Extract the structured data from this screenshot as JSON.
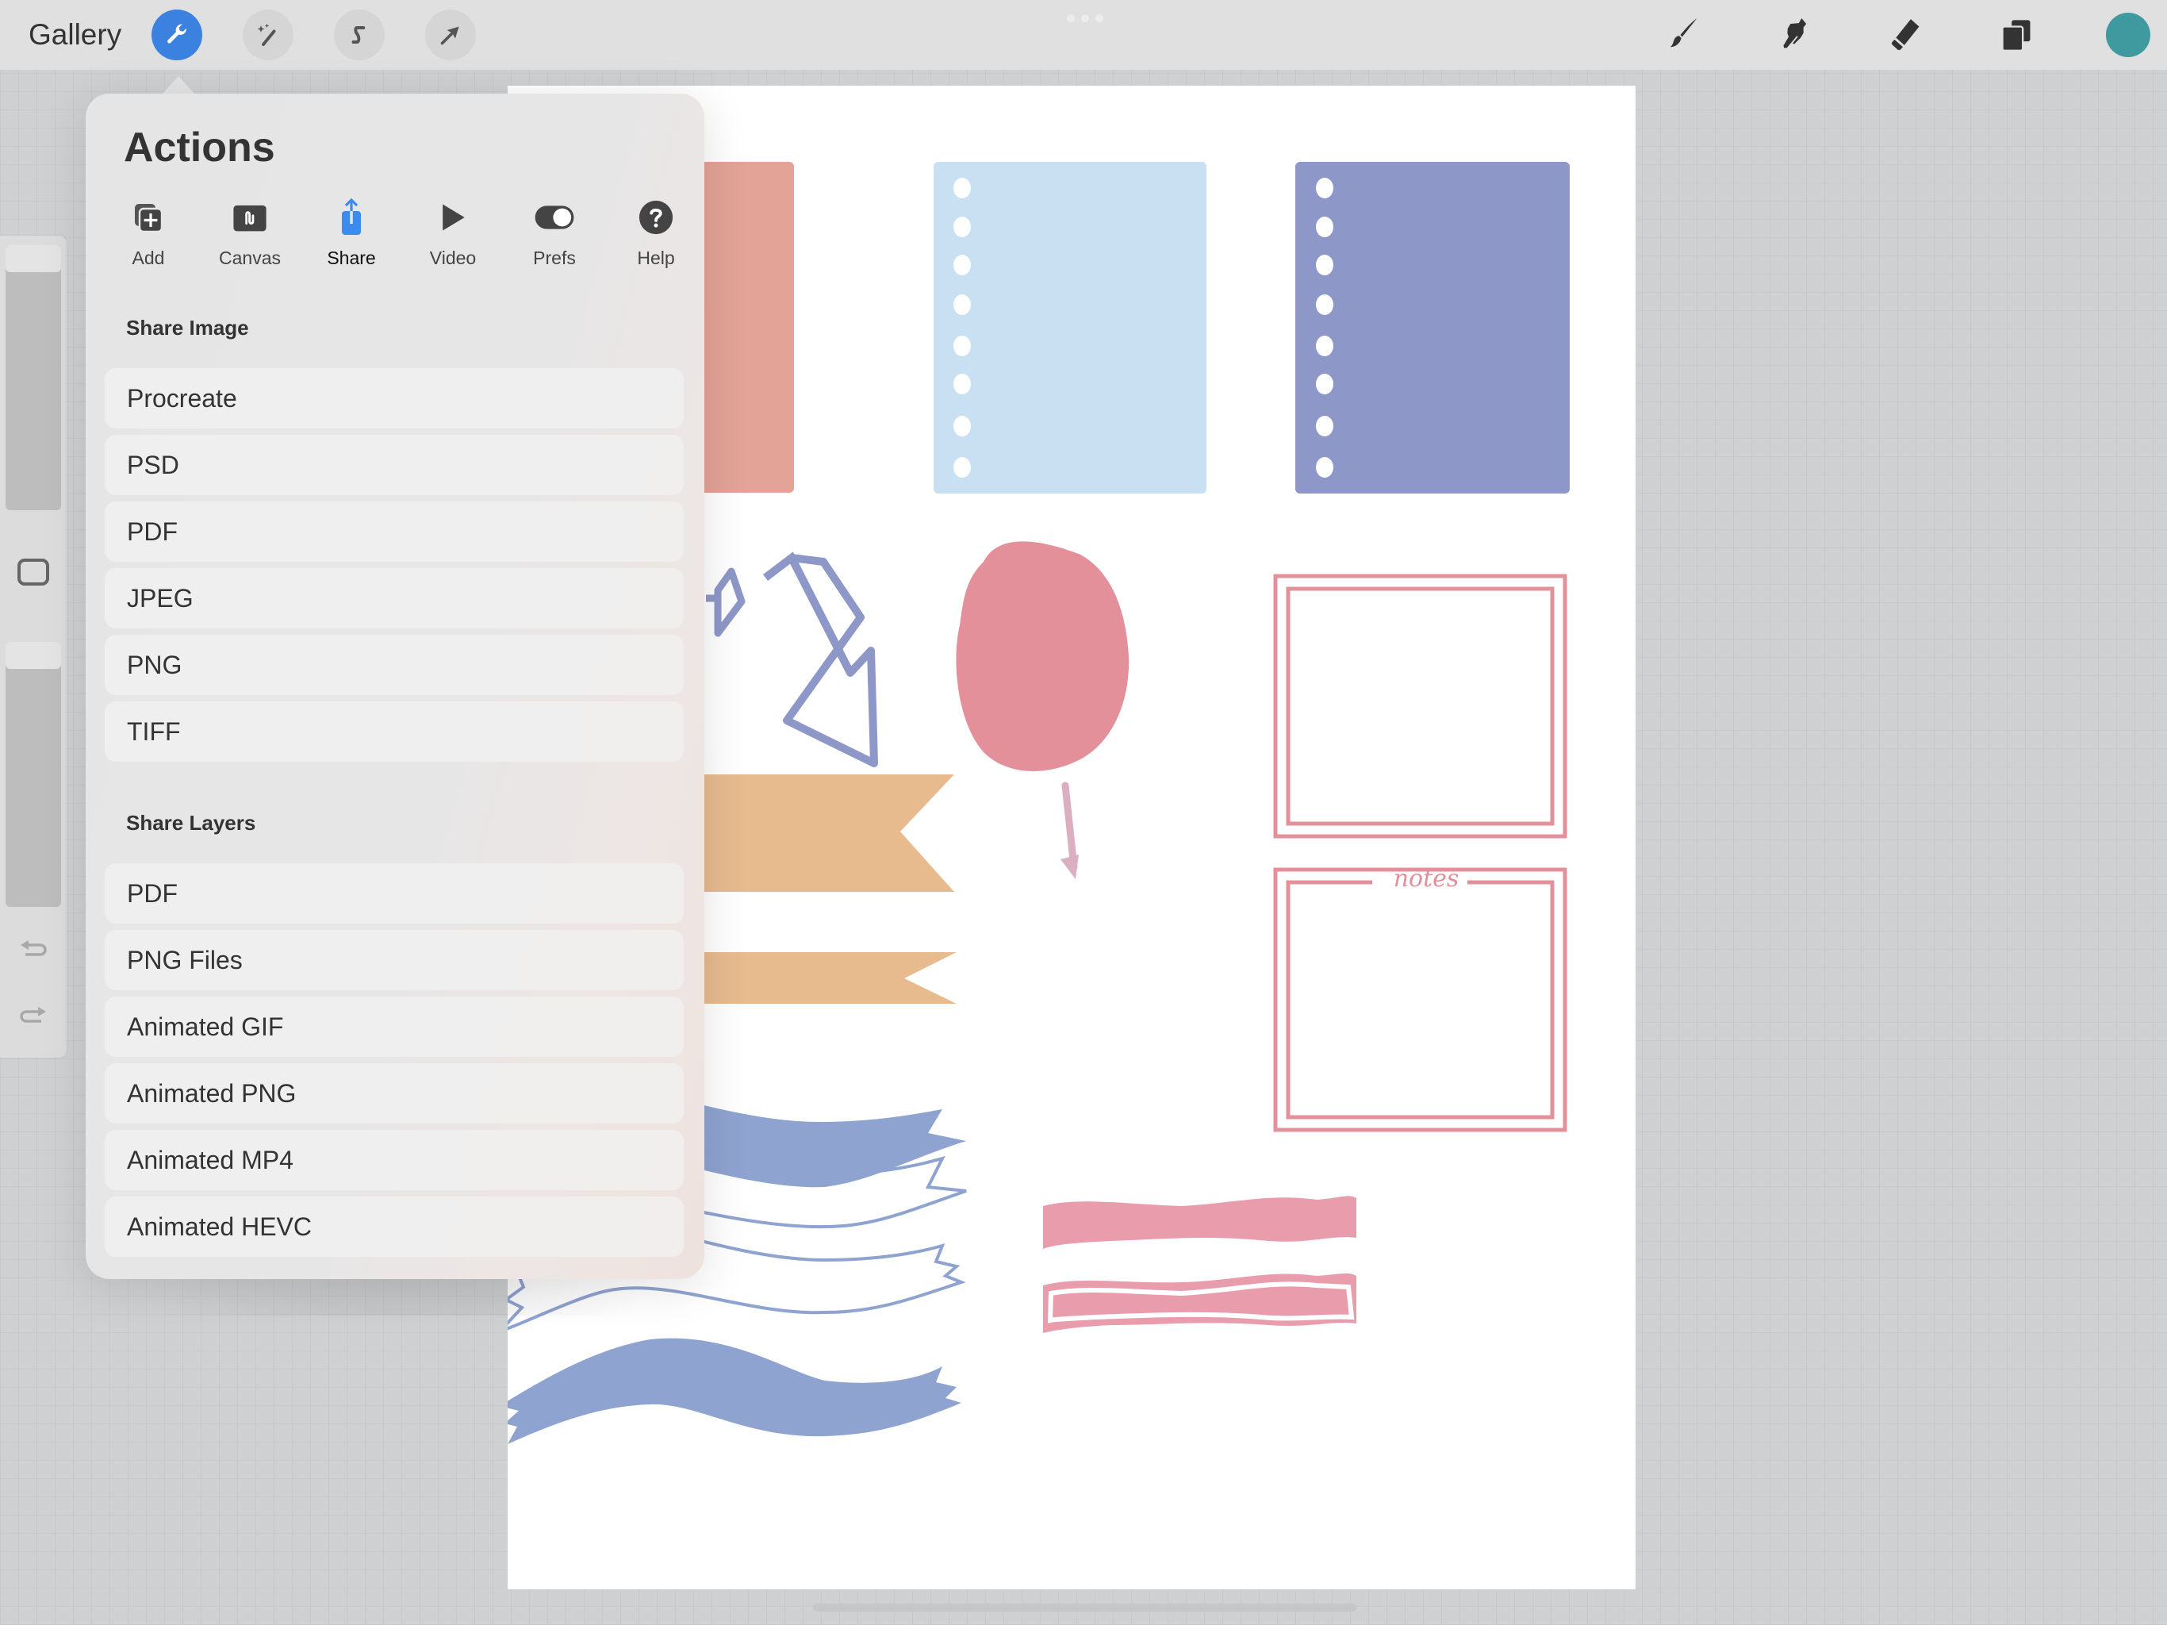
{
  "topbar": {
    "gallery_label": "Gallery",
    "left_tools": [
      {
        "name": "actions",
        "icon": "wrench-icon",
        "active": true
      },
      {
        "name": "adjustments",
        "icon": "magic-wand-icon",
        "active": false
      },
      {
        "name": "selection",
        "icon": "selection-s-icon",
        "active": false
      },
      {
        "name": "transform",
        "icon": "cursor-arrow-icon",
        "active": false
      }
    ],
    "right_tools": [
      {
        "name": "brush",
        "icon": "paintbrush-icon"
      },
      {
        "name": "smudge",
        "icon": "smudge-finger-icon"
      },
      {
        "name": "eraser",
        "icon": "eraser-icon"
      },
      {
        "name": "layers",
        "icon": "layers-icon"
      }
    ],
    "current_color": "#3f9aa0",
    "active_accent": "#3b82e0"
  },
  "sidebar": {
    "brush_size_label": "Brush size",
    "opacity_label": "Opacity",
    "modify_label": "Modify",
    "undo_label": "Undo",
    "redo_label": "Redo"
  },
  "actions_panel": {
    "title": "Actions",
    "tabs": [
      {
        "label": "Add",
        "icon": "add-layer-icon",
        "active": false
      },
      {
        "label": "Canvas",
        "icon": "canvas-icon",
        "active": false
      },
      {
        "label": "Share",
        "icon": "share-icon",
        "active": true
      },
      {
        "label": "Video",
        "icon": "play-icon",
        "active": false
      },
      {
        "label": "Prefs",
        "icon": "toggle-icon",
        "active": false
      },
      {
        "label": "Help",
        "icon": "help-icon",
        "active": false
      }
    ],
    "share_image": {
      "heading": "Share Image",
      "items": [
        "Procreate",
        "PSD",
        "PDF",
        "JPEG",
        "PNG",
        "TIFF"
      ]
    },
    "share_layers": {
      "heading": "Share Layers",
      "items": [
        "PDF",
        "PNG Files",
        "Animated GIF",
        "Animated PNG",
        "Animated MP4",
        "Animated HEVC"
      ]
    }
  },
  "canvas": {
    "notes_label": "notes",
    "palette": {
      "coral": "#e3a396",
      "light_blue": "#c9dff2",
      "periwinkle": "#8e98c8",
      "pink": "#e3909a",
      "peach": "#e8bb8f",
      "ribbon_blue": "#8fa3d0",
      "highlight_pink": "#e89cac",
      "arrow_pink": "#dcafc0"
    }
  }
}
